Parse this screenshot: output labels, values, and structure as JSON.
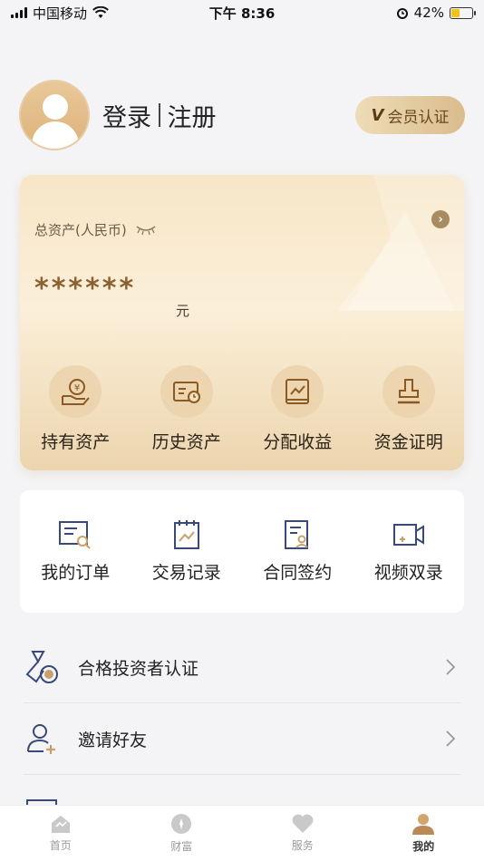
{
  "status_bar": {
    "carrier": "中国移动",
    "time": "下午 8:36",
    "battery": "42%",
    "battery_level": 0.42
  },
  "profile": {
    "login_label": "登录",
    "register_label": "注册",
    "member_badge": "V",
    "member_label": "会员认证"
  },
  "asset": {
    "label": "总资产(人民币)",
    "value": "******",
    "unit": "元",
    "quick": [
      {
        "label": "持有资产",
        "icon": "hand-yuan-icon"
      },
      {
        "label": "历史资产",
        "icon": "card-clock-icon"
      },
      {
        "label": "分配收益",
        "icon": "chart-book-icon"
      },
      {
        "label": "资金证明",
        "icon": "stamp-icon"
      }
    ]
  },
  "orders": [
    {
      "label": "我的订单",
      "icon": "order-search-icon"
    },
    {
      "label": "交易记录",
      "icon": "trade-record-icon"
    },
    {
      "label": "合同签约",
      "icon": "contract-sign-icon"
    },
    {
      "label": "视频双录",
      "icon": "video-record-icon"
    }
  ],
  "list": [
    {
      "label": "合格投资者认证",
      "icon": "investor-medal-icon"
    },
    {
      "label": "邀请好友",
      "icon": "add-friend-icon"
    }
  ],
  "tabs": [
    {
      "label": "首页",
      "icon": "home-icon",
      "active": false
    },
    {
      "label": "财富",
      "icon": "wealth-icon",
      "active": false
    },
    {
      "label": "服务",
      "icon": "heart-icon",
      "active": false
    },
    {
      "label": "我的",
      "icon": "user-icon",
      "active": true
    }
  ],
  "colors": {
    "accent_gold": "#a98b62",
    "navy_icon": "#3a4a78",
    "gold_icon": "#c8a16a"
  }
}
